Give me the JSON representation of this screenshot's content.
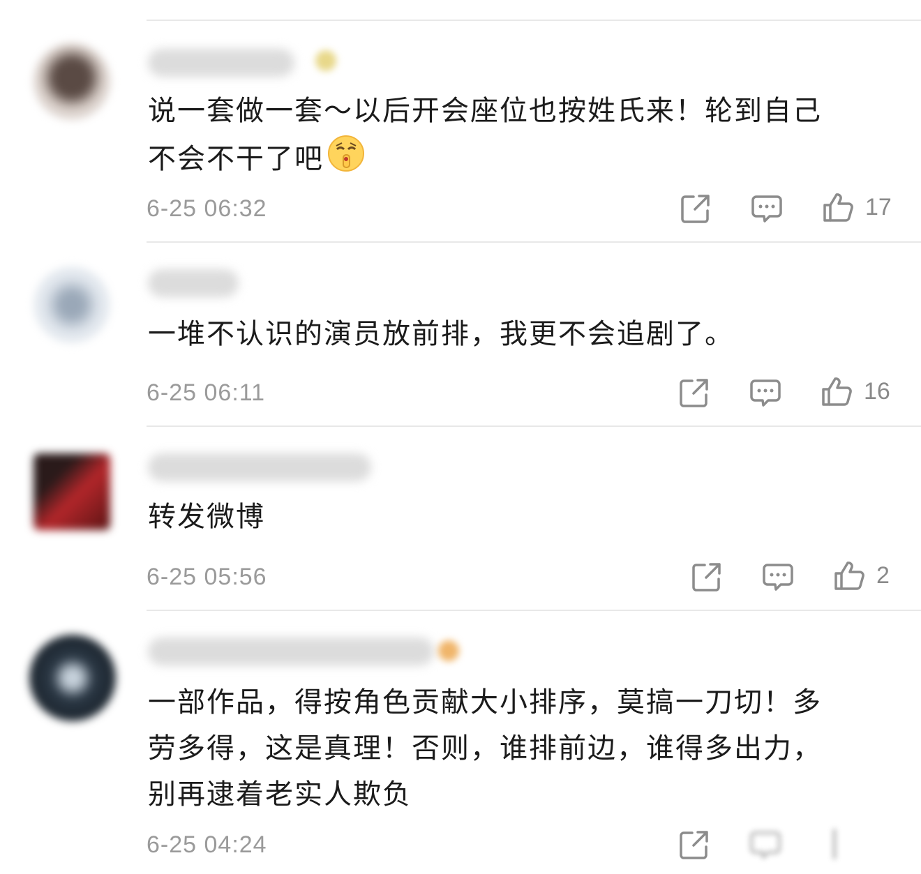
{
  "comments": [
    {
      "text": "说一套做一套～以后开会座位也按姓氏来！轮到自己\n不会不干了吧",
      "emoji": "shushing-face-emoji",
      "time": "6-25 06:32",
      "likes": "17"
    },
    {
      "text": "一堆不认识的演员放前排，我更不会追剧了。",
      "time": "6-25 06:11",
      "likes": "16"
    },
    {
      "text": "转发微博",
      "time": "6-25 05:56",
      "likes": "2"
    },
    {
      "text": "一部作品，得按角色贡献大小排序，莫搞一刀切！多\n劳多得，这是真理！否则，谁排前边，谁得多出力，\n别再逮着老实人欺负",
      "time": "6-25 04:24",
      "likes": ""
    }
  ],
  "icons": {
    "share": "share-icon",
    "reply": "comment-icon",
    "like": "thumbs-up-icon"
  },
  "colors": {
    "text": "#1b1b1b",
    "meta": "#9a9a9a",
    "icon": "#8c8c8c",
    "divider": "#e8e8e8"
  }
}
